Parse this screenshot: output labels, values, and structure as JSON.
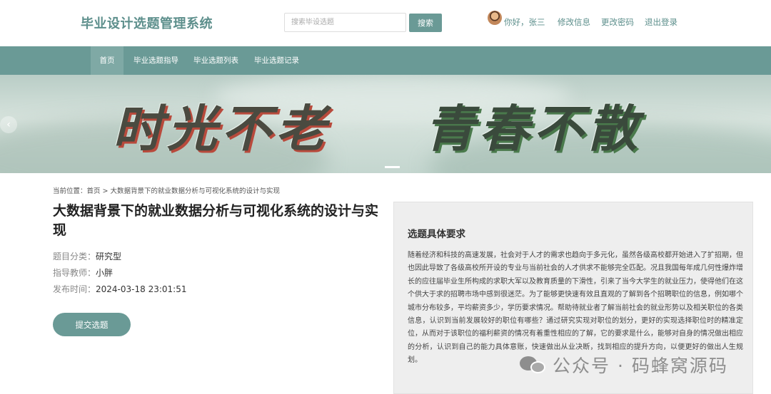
{
  "header": {
    "logo": "毕业设计选题管理系统",
    "search_placeholder": "搜索毕设选题",
    "search_button": "搜索",
    "greeting": "你好，张三",
    "links": [
      "修改信息",
      "更改密码",
      "退出登录"
    ]
  },
  "nav": {
    "items": [
      "首页",
      "毕业选题指导",
      "毕业选题列表",
      "毕业选题记录"
    ],
    "active_index": 0
  },
  "banner": {
    "text_left": "时光不老",
    "text_right": "青春不散",
    "prev_arrow": "‹"
  },
  "breadcrumb": {
    "prefix": "当前位置：",
    "home": "首页",
    "separator": " > ",
    "current": "大数据背景下的就业数据分析与可视化系统的设计与实现"
  },
  "topic": {
    "title": "大数据背景下的就业数据分析与可视化系统的设计与实现",
    "category_label": "题目分类：",
    "category": "研究型",
    "teacher_label": "指导教师：",
    "teacher": "小胖",
    "time_label": "发布时间：",
    "time": "2024-03-18 23:01:51",
    "submit_button": "提交选题"
  },
  "requirements": {
    "title": "选题具体要求",
    "body": "随着经济和科技的高速发展，社会对于人才的需求也趋向于多元化，虽然各级高校都开始进入了扩招期，但也因此导致了各级高校所开设的专业与当前社会的人才供求不能够完全匹配。况且我国每年成几何性爆炸增长的应往届毕业生所构成的求职大军以及教育质量的下滑性，引来了当今大学生的就业压力，使得他们在这个供大于求的招聘市场中感到很迷茫。为了能够更快速有效且直观的了解到各个招聘职位的信息，例如哪个城市分布较多，平均薪资多少，学历要求情况。帮助待就业者了解当前社会的就业形势以及相关职位的各类信息，认识到当前发展较好的职位有哪些？通过研究实现对职位的划分，更好的实现选择职位时的精准定位，从而对于该职位的福利薪资的情况有着重性相应的了解，它的要求是什么，能够对自身的情况做出相应的分析，认识到自己的能力具体意账，快速做出从业决断，找到相应的提升方向，以便更好的做出人生规划。"
  },
  "watermark": {
    "text": "公众号 · 码蜂窝源码"
  },
  "colors": {
    "accent": "#6a9a96",
    "logo": "#5d8f8c",
    "panel_bg": "#eeeeee"
  }
}
